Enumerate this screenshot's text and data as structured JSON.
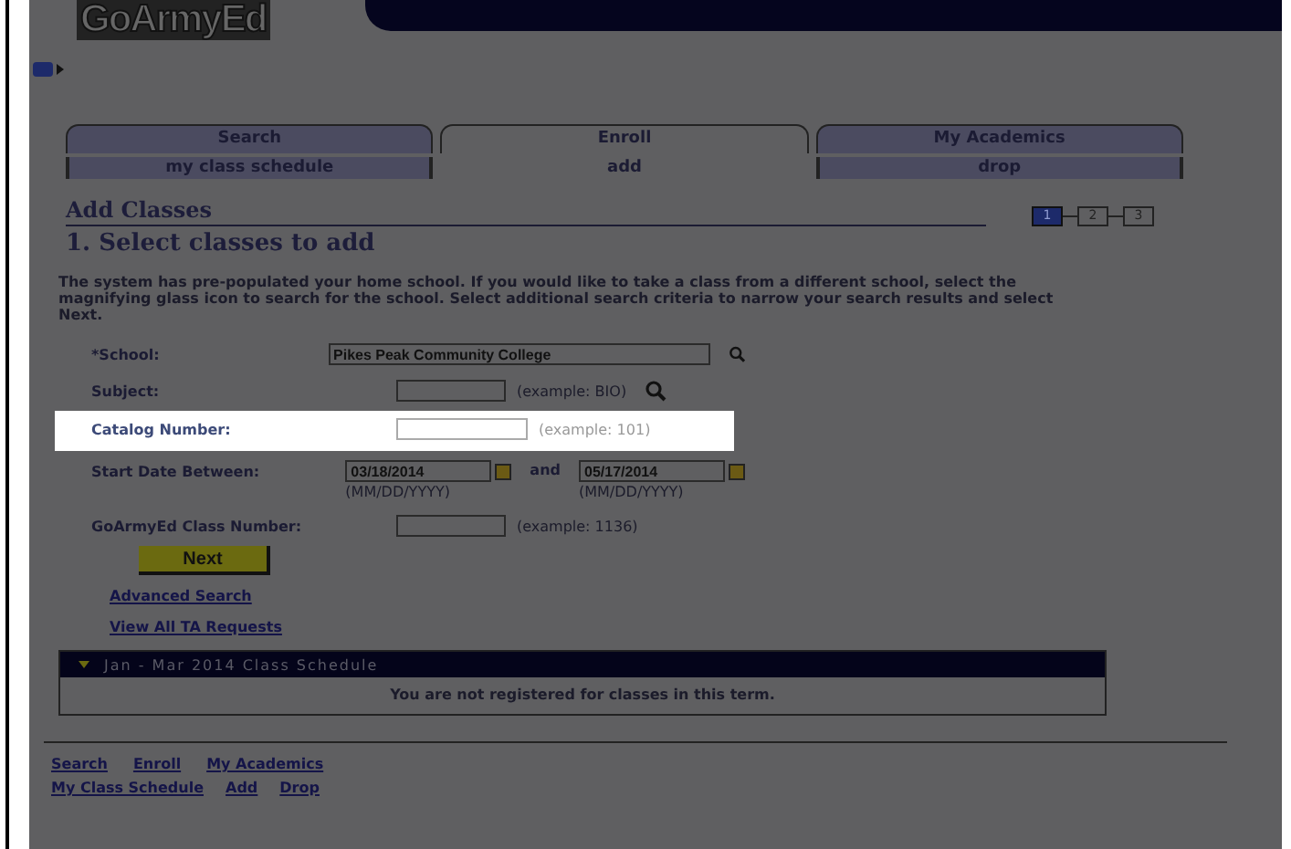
{
  "header": {
    "logo": "GoArmyEd"
  },
  "tabs": [
    {
      "label": "Search",
      "selected": false
    },
    {
      "label": "Enroll",
      "selected": true
    },
    {
      "label": "My Academics",
      "selected": false
    }
  ],
  "subtabs": [
    {
      "label": "my class schedule",
      "selected": false
    },
    {
      "label": "add",
      "selected": true
    },
    {
      "label": "drop",
      "selected": false
    }
  ],
  "page_title": "Add Classes",
  "section_title": "1. Select classes to add",
  "steps": [
    {
      "label": "1",
      "selected": true
    },
    {
      "label": "2",
      "selected": false
    },
    {
      "label": "3",
      "selected": false
    }
  ],
  "instructions": "The system has pre-populated your home school. If you would like to take a class from a different school, select the magnifying glass icon to search for the school. Select additional search criteria to narrow your search results and select Next.",
  "form": [
    {
      "kind": "text",
      "label": "*School:",
      "value": "Pikes Peak Community College",
      "wide": true,
      "search": true,
      "highlighted": false
    },
    {
      "kind": "text",
      "label": "Subject:",
      "hint": "(example: BIO)",
      "search": true,
      "highlighted": false
    },
    {
      "kind": "text",
      "label": "Catalog Number:",
      "hint": "(example: 101)",
      "search": false,
      "highlighted": true
    },
    {
      "kind": "dates",
      "label": "Start Date Between:",
      "from": "03/18/2014",
      "joiner": "and",
      "to": "05/17/2014",
      "format_from": "(MM/DD/YYYY)",
      "format_to": "(MM/DD/YYYY)",
      "highlighted": false
    },
    {
      "kind": "text",
      "label": "GoArmyEd Class Number:",
      "hint": "(example: 1136)",
      "search": false,
      "highlighted": false
    }
  ],
  "next_button": "Next",
  "links": [
    "Advanced Search",
    "View All TA Requests"
  ],
  "schedule": {
    "title": "Jan - Mar 2014 Class Schedule",
    "expanded": true,
    "message": "You are not registered for classes in this term."
  },
  "footer": {
    "row_1": [
      "Search",
      "Enroll",
      "My Academics"
    ],
    "row_2": [
      "My Class Schedule",
      "Add",
      "Drop"
    ]
  }
}
